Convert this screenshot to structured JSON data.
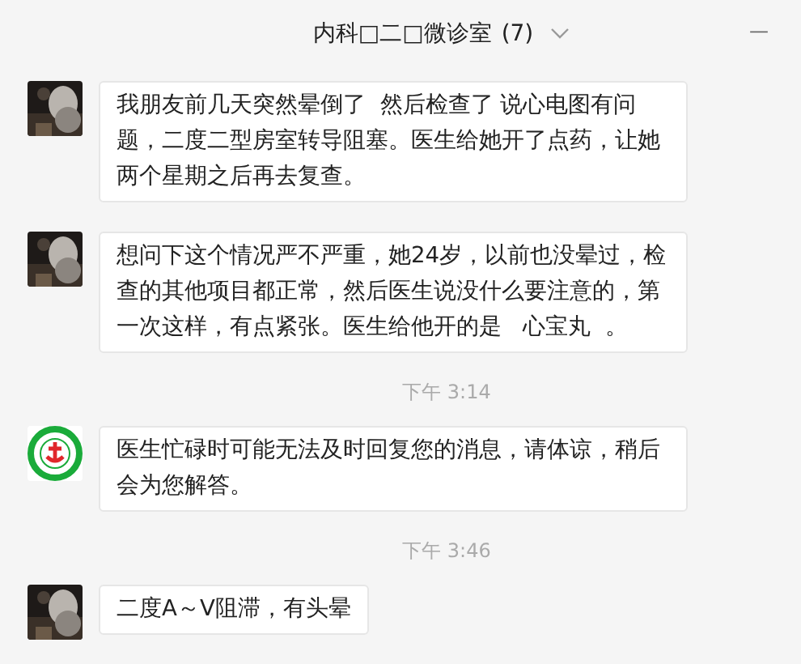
{
  "header": {
    "title": "内科□二□微诊室",
    "count": "(7)",
    "minimize": "—"
  },
  "messages": [
    {
      "kind": "message",
      "text": "我朋友前几天突然晕倒了  然后检查了 说心电图有问题，二度二型房室转导阻塞。医生给她开了点药，让她两个星期之后再去复查。"
    },
    {
      "kind": "message",
      "text": "想问下这个情况严不严重，她24岁，以前也没晕过，检查的其他项目都正常，然后医生说没什么要注意的，第一次这样，有点紧张。医生给他开的是   心宝丸  。"
    },
    {
      "kind": "time",
      "text": "下午 3:14"
    },
    {
      "kind": "message",
      "avatar": {
        "kind": "logo"
      },
      "text": "医生忙碌时可能无法及时回复您的消息，请体谅，稍后会为您解答。"
    },
    {
      "kind": "time",
      "text": "下午 3:46"
    },
    {
      "kind": "message",
      "text": "二度A～V阻滞，有头晕"
    }
  ]
}
